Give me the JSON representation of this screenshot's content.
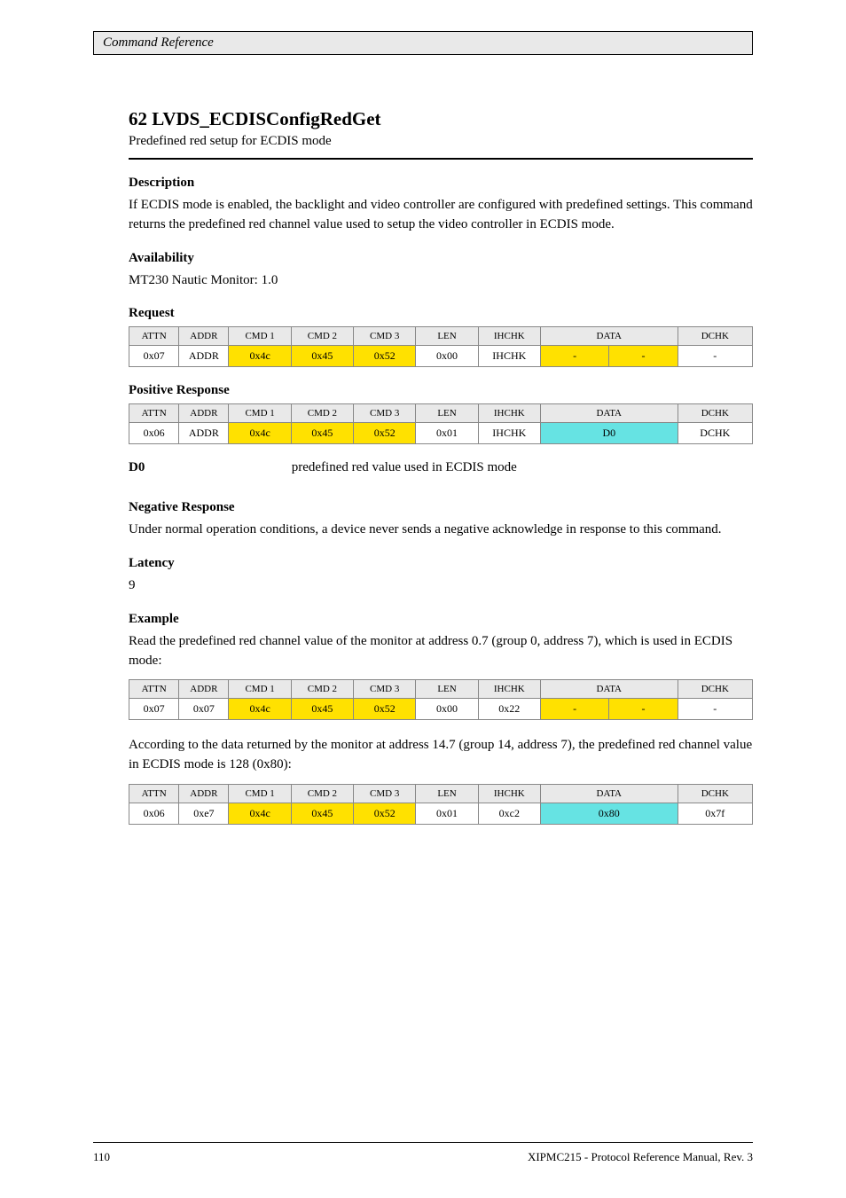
{
  "header": {
    "running": "Command Reference"
  },
  "cmd": {
    "title": "62 LVDS_ECDISConfigRedGet",
    "subtitle": "Predefined red setup for ECDIS mode"
  },
  "descLabel": "Description",
  "descText": "If ECDIS mode is enabled, the backlight and video controller are configured with predefined settings. This command returns the predefined red channel value used to setup the video controller in ECDIS mode.",
  "availLabel": "Availability",
  "availText": "MT230 Nautic Monitor: 1.0",
  "reqLabel": "Request",
  "respLabel": "Positive Response",
  "cols": {
    "attn": "ATTN",
    "addr": "ADDR",
    "cmd1": "CMD 1",
    "cmd2": "CMD 2",
    "cmd3": "CMD 3",
    "len": "LEN",
    "ihchk": "IHCHK",
    "data": "DATA",
    "dchk": "DCHK"
  },
  "req": {
    "attn": "0x07",
    "addr": "ADDR",
    "cmd1": "0x4c",
    "cmd2": "0x45",
    "cmd3": "0x52",
    "len": "0x00",
    "ihchk": "IHCHK",
    "data": "-    -",
    "dchk": "-"
  },
  "resp": {
    "attn": "0x06",
    "addr": "ADDR",
    "cmd1": "0x4c",
    "cmd2": "0x45",
    "cmd3": "0x52",
    "len": "0x01",
    "ihchk": "IHCHK",
    "data": "D0",
    "dchk": "DCHK"
  },
  "param": {
    "label": "D0",
    "desc": "predefined red value used in ECDIS mode"
  },
  "negLabel": "Negative Response",
  "negText": "Under normal operation conditions, a device never sends a negative acknowledge in response to this command.",
  "latLabel": "Latency",
  "latText": "9",
  "exLabel": "Example",
  "exReqText": "Read the predefined red channel value of the monitor at address 0.7 (group 0, address 7), which is used in ECDIS mode:",
  "exReq": {
    "attn": "0x07",
    "addr": "0x07",
    "cmd1": "0x4c",
    "cmd2": "0x45",
    "cmd3": "0x52",
    "len": "0x00",
    "ihchk": "0x22",
    "data": "-    -",
    "dchk": "-"
  },
  "exRespText": "According to the data returned by the monitor at address 14.7 (group 14, address 7), the predefined red channel value in ECDIS mode is 128 (0x80):",
  "exResp": {
    "attn": "0x06",
    "addr": "0xe7",
    "cmd1": "0x4c",
    "cmd2": "0x45",
    "cmd3": "0x52",
    "len": "0x01",
    "ihchk": "0xc2",
    "data": "0x80",
    "dchk": "0x7f"
  },
  "footer": {
    "page": "110",
    "doc": "XIPMC215 - Protocol Reference Manual, Rev. 3"
  }
}
